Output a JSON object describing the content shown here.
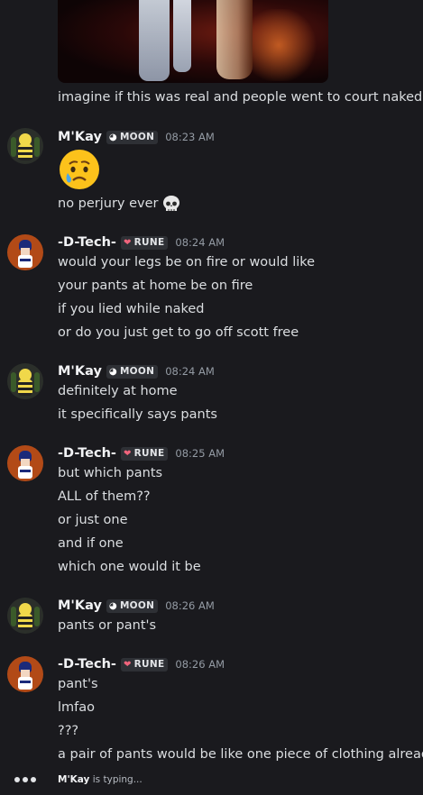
{
  "colors": {
    "background": "#1a1a1e",
    "text": "#dbdee1",
    "username": "#f2f3f5",
    "timestamp": "#949ba4",
    "badge_bg": "#2e3035",
    "rune_heart": "#f0647c"
  },
  "messages": {
    "caption": "imagine if this was real and people went to court naked",
    "g1": {
      "user": "M'Kay",
      "badge": "MOON",
      "badge_icon": "moon-icon",
      "time": "08:23 AM",
      "emoji": "crying-face-emoji",
      "line1": "no perjury ever",
      "line1_emoji": "skull-emoji"
    },
    "g2": {
      "user": "-D-Tech-",
      "badge": "RUNE",
      "badge_icon": "heart-icon",
      "time": "08:24 AM",
      "lines": [
        "would your legs be on fire or would like",
        "your pants at home be on fire",
        "if you lied while naked",
        "or do you just get to go off scott free"
      ]
    },
    "g3": {
      "user": "M'Kay",
      "badge": "MOON",
      "badge_icon": "moon-icon",
      "time": "08:24 AM",
      "lines": [
        "definitely at home",
        "it specifically says pants"
      ]
    },
    "g4": {
      "user": "-D-Tech-",
      "badge": "RUNE",
      "badge_icon": "heart-icon",
      "time": "08:25 AM",
      "lines": [
        "but which pants",
        "ALL of them??",
        "or just one",
        "and if one",
        "which one would it be"
      ]
    },
    "g5": {
      "user": "M'Kay",
      "badge": "MOON",
      "badge_icon": "moon-icon",
      "time": "08:26 AM",
      "lines": [
        "pants or pant's"
      ]
    },
    "g6": {
      "user": "-D-Tech-",
      "badge": "RUNE",
      "badge_icon": "heart-icon",
      "time": "08:26 AM",
      "lines": [
        "pant's",
        "lmfao",
        "???",
        "a pair of pants would be like one piece of clothing already"
      ]
    }
  },
  "typing": {
    "user": "M'Kay",
    "suffix": "is typing..."
  }
}
